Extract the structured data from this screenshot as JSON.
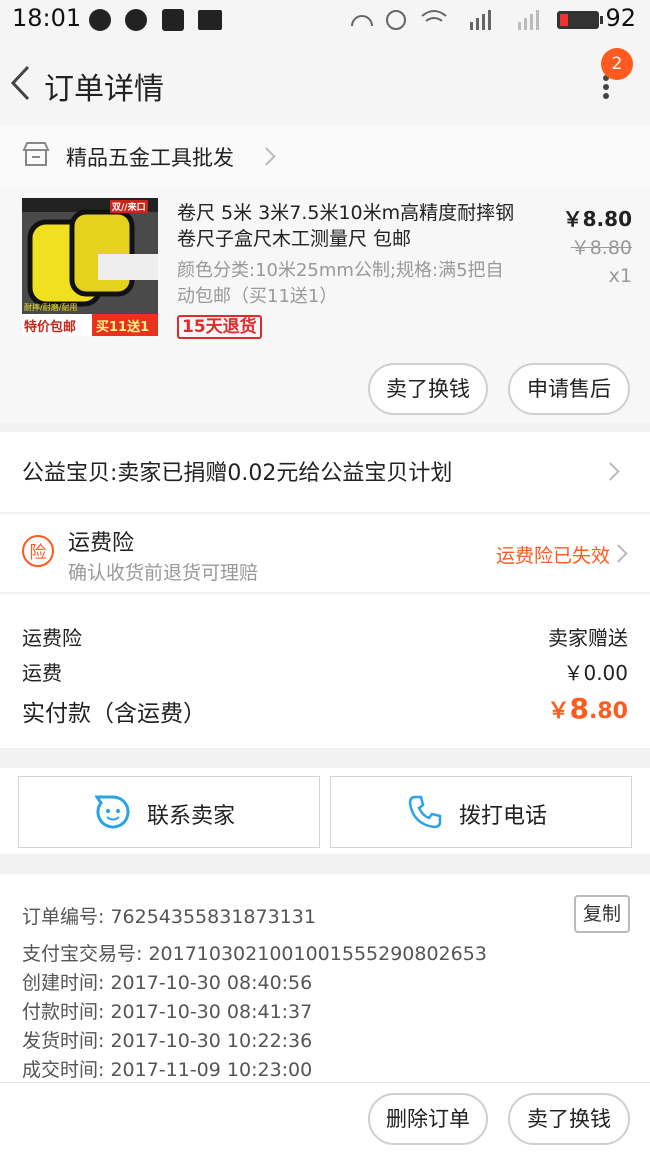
{
  "status_bar": {
    "time": "18:01",
    "battery": "92"
  },
  "header": {
    "title": "订单详情",
    "badge_count": "2"
  },
  "shop": {
    "name": "精品五金工具批发"
  },
  "product": {
    "title": "卷尺 5米 3米7.5米10米m高精度耐摔钢卷尺子盒尺木工测量尺 包邮",
    "spec": "颜色分类:10米25mm公制;规格:满5把自动包邮（买11送1）",
    "return_badge": "15天退货",
    "price": "￥8.80",
    "original_price": "￥8.80",
    "quantity": "x1",
    "thumb_labels": {
      "brand": "双//来口",
      "promo_left": "特价包邮",
      "promo_right": "买11送1",
      "small": "耐摔/耐磨/耐用"
    },
    "actions": [
      "卖了换钱",
      "申请售后"
    ]
  },
  "charity": {
    "text": "公益宝贝:卖家已捐赠0.02元给公益宝贝计划"
  },
  "insurance": {
    "icon_char": "险",
    "title": "运费险",
    "subtitle": "确认收货前退货可理赔",
    "status": "运费险已失效"
  },
  "cost": {
    "rows": [
      {
        "label": "运费险",
        "value": "卖家赠送"
      },
      {
        "label": "运费",
        "value": "￥0.00"
      }
    ],
    "total_label": "实付款（含运费）",
    "total_currency": "￥",
    "total_int": "8",
    "total_dec": ".80"
  },
  "contact": {
    "seller": "联系卖家",
    "call": "拨打电话"
  },
  "order_info": {
    "lines": [
      "订单编号: 76254355831873131",
      "支付宝交易号: 2017103021001001555290802653",
      "创建时间: 2017-10-30 08:40:56",
      "付款时间: 2017-10-30 08:41:37",
      "发货时间: 2017-10-30 10:22:36",
      "成交时间: 2017-11-09 10:23:00"
    ],
    "copy_label": "复制"
  },
  "bottom_actions": [
    "删除订单",
    "卖了换钱"
  ],
  "colors": {
    "accent": "#ff5a1f",
    "return_red": "#e02b2b",
    "contact_blue": "#29a3e6"
  }
}
